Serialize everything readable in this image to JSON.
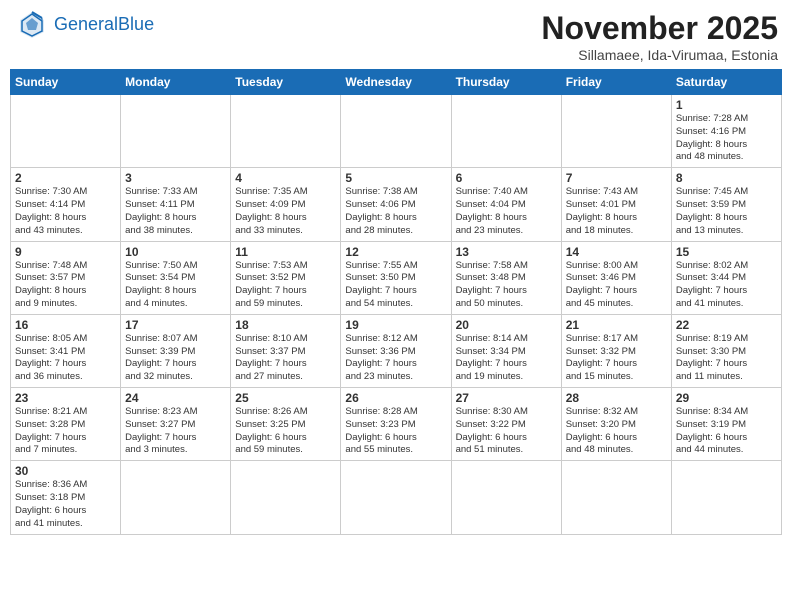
{
  "header": {
    "logo_general": "General",
    "logo_blue": "Blue",
    "title": "November 2025",
    "subtitle": "Sillamaee, Ida-Virumaa, Estonia"
  },
  "weekdays": [
    "Sunday",
    "Monday",
    "Tuesday",
    "Wednesday",
    "Thursday",
    "Friday",
    "Saturday"
  ],
  "weeks": [
    [
      {
        "day": "",
        "info": ""
      },
      {
        "day": "",
        "info": ""
      },
      {
        "day": "",
        "info": ""
      },
      {
        "day": "",
        "info": ""
      },
      {
        "day": "",
        "info": ""
      },
      {
        "day": "",
        "info": ""
      },
      {
        "day": "1",
        "info": "Sunrise: 7:28 AM\nSunset: 4:16 PM\nDaylight: 8 hours\nand 48 minutes."
      }
    ],
    [
      {
        "day": "2",
        "info": "Sunrise: 7:30 AM\nSunset: 4:14 PM\nDaylight: 8 hours\nand 43 minutes."
      },
      {
        "day": "3",
        "info": "Sunrise: 7:33 AM\nSunset: 4:11 PM\nDaylight: 8 hours\nand 38 minutes."
      },
      {
        "day": "4",
        "info": "Sunrise: 7:35 AM\nSunset: 4:09 PM\nDaylight: 8 hours\nand 33 minutes."
      },
      {
        "day": "5",
        "info": "Sunrise: 7:38 AM\nSunset: 4:06 PM\nDaylight: 8 hours\nand 28 minutes."
      },
      {
        "day": "6",
        "info": "Sunrise: 7:40 AM\nSunset: 4:04 PM\nDaylight: 8 hours\nand 23 minutes."
      },
      {
        "day": "7",
        "info": "Sunrise: 7:43 AM\nSunset: 4:01 PM\nDaylight: 8 hours\nand 18 minutes."
      },
      {
        "day": "8",
        "info": "Sunrise: 7:45 AM\nSunset: 3:59 PM\nDaylight: 8 hours\nand 13 minutes."
      }
    ],
    [
      {
        "day": "9",
        "info": "Sunrise: 7:48 AM\nSunset: 3:57 PM\nDaylight: 8 hours\nand 9 minutes."
      },
      {
        "day": "10",
        "info": "Sunrise: 7:50 AM\nSunset: 3:54 PM\nDaylight: 8 hours\nand 4 minutes."
      },
      {
        "day": "11",
        "info": "Sunrise: 7:53 AM\nSunset: 3:52 PM\nDaylight: 7 hours\nand 59 minutes."
      },
      {
        "day": "12",
        "info": "Sunrise: 7:55 AM\nSunset: 3:50 PM\nDaylight: 7 hours\nand 54 minutes."
      },
      {
        "day": "13",
        "info": "Sunrise: 7:58 AM\nSunset: 3:48 PM\nDaylight: 7 hours\nand 50 minutes."
      },
      {
        "day": "14",
        "info": "Sunrise: 8:00 AM\nSunset: 3:46 PM\nDaylight: 7 hours\nand 45 minutes."
      },
      {
        "day": "15",
        "info": "Sunrise: 8:02 AM\nSunset: 3:44 PM\nDaylight: 7 hours\nand 41 minutes."
      }
    ],
    [
      {
        "day": "16",
        "info": "Sunrise: 8:05 AM\nSunset: 3:41 PM\nDaylight: 7 hours\nand 36 minutes."
      },
      {
        "day": "17",
        "info": "Sunrise: 8:07 AM\nSunset: 3:39 PM\nDaylight: 7 hours\nand 32 minutes."
      },
      {
        "day": "18",
        "info": "Sunrise: 8:10 AM\nSunset: 3:37 PM\nDaylight: 7 hours\nand 27 minutes."
      },
      {
        "day": "19",
        "info": "Sunrise: 8:12 AM\nSunset: 3:36 PM\nDaylight: 7 hours\nand 23 minutes."
      },
      {
        "day": "20",
        "info": "Sunrise: 8:14 AM\nSunset: 3:34 PM\nDaylight: 7 hours\nand 19 minutes."
      },
      {
        "day": "21",
        "info": "Sunrise: 8:17 AM\nSunset: 3:32 PM\nDaylight: 7 hours\nand 15 minutes."
      },
      {
        "day": "22",
        "info": "Sunrise: 8:19 AM\nSunset: 3:30 PM\nDaylight: 7 hours\nand 11 minutes."
      }
    ],
    [
      {
        "day": "23",
        "info": "Sunrise: 8:21 AM\nSunset: 3:28 PM\nDaylight: 7 hours\nand 7 minutes."
      },
      {
        "day": "24",
        "info": "Sunrise: 8:23 AM\nSunset: 3:27 PM\nDaylight: 7 hours\nand 3 minutes."
      },
      {
        "day": "25",
        "info": "Sunrise: 8:26 AM\nSunset: 3:25 PM\nDaylight: 6 hours\nand 59 minutes."
      },
      {
        "day": "26",
        "info": "Sunrise: 8:28 AM\nSunset: 3:23 PM\nDaylight: 6 hours\nand 55 minutes."
      },
      {
        "day": "27",
        "info": "Sunrise: 8:30 AM\nSunset: 3:22 PM\nDaylight: 6 hours\nand 51 minutes."
      },
      {
        "day": "28",
        "info": "Sunrise: 8:32 AM\nSunset: 3:20 PM\nDaylight: 6 hours\nand 48 minutes."
      },
      {
        "day": "29",
        "info": "Sunrise: 8:34 AM\nSunset: 3:19 PM\nDaylight: 6 hours\nand 44 minutes."
      }
    ],
    [
      {
        "day": "30",
        "info": "Sunrise: 8:36 AM\nSunset: 3:18 PM\nDaylight: 6 hours\nand 41 minutes."
      },
      {
        "day": "",
        "info": ""
      },
      {
        "day": "",
        "info": ""
      },
      {
        "day": "",
        "info": ""
      },
      {
        "day": "",
        "info": ""
      },
      {
        "day": "",
        "info": ""
      },
      {
        "day": "",
        "info": ""
      }
    ]
  ]
}
